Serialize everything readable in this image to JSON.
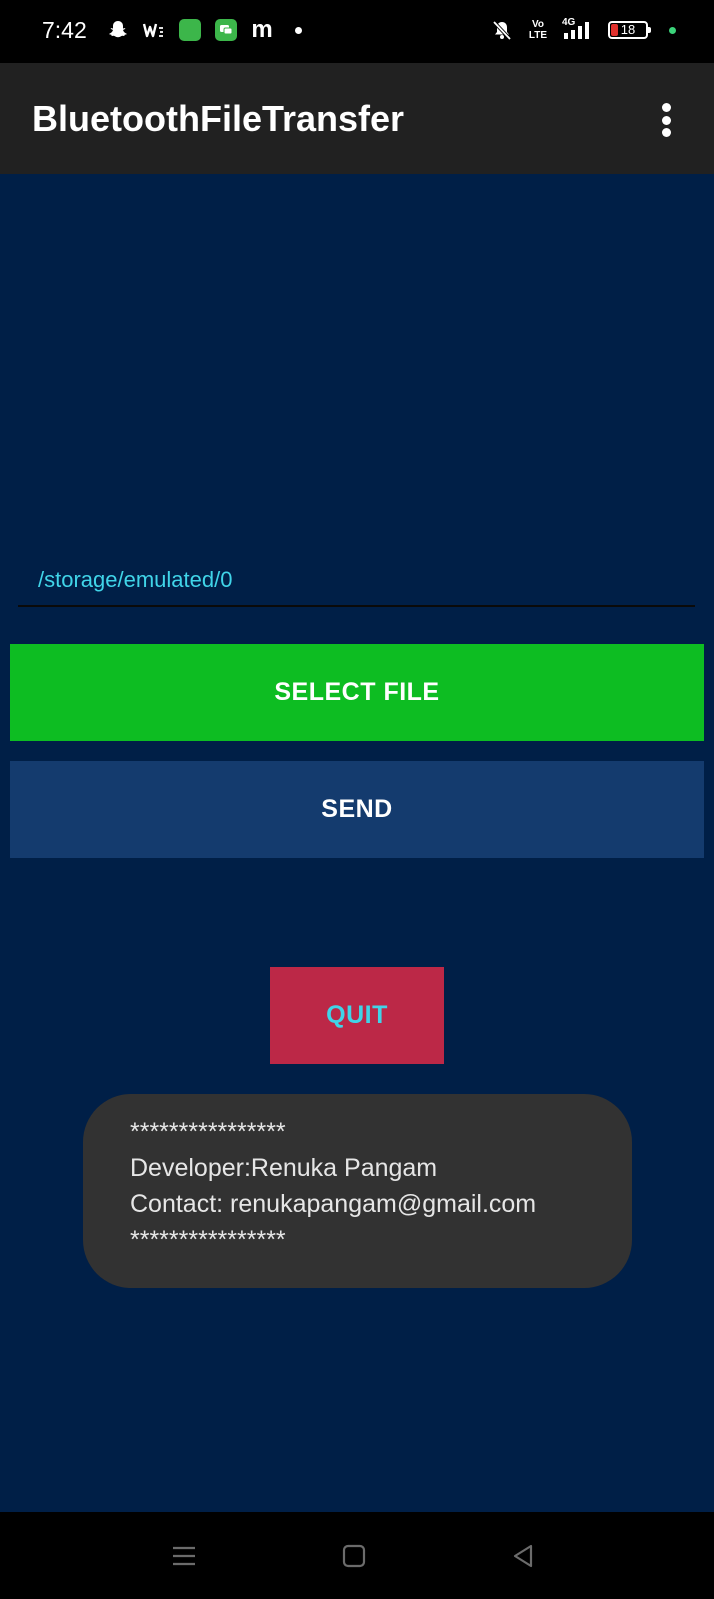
{
  "status_bar": {
    "time": "7:42",
    "battery_level": "18",
    "left_icons": [
      "snapchat-icon",
      "wifi-calling-icon",
      "green-app-icon",
      "messages-icon",
      "m-app-icon",
      "notification-dot"
    ],
    "right_icons": [
      "bell-muted-icon",
      "volte-icon",
      "signal-4g-icon",
      "battery-icon",
      "green-dot"
    ],
    "volte_label_top": "Vo",
    "volte_label_bottom": "LTE",
    "network_label": "4G"
  },
  "app_bar": {
    "title": "BluetoothFileTransfer",
    "menu_icon": "overflow-menu-icon"
  },
  "main": {
    "path_value": "/storage/emulated/0",
    "select_file_label": "SELECT FILE",
    "send_label": "SEND",
    "quit_label": "QUIT"
  },
  "toast": {
    "line1": "****************",
    "line2": "Developer:Renuka Pangam",
    "line3": "Contact: renukapangam@gmail.com",
    "line4": "****************"
  },
  "nav_bar": {
    "icons": [
      "recent-apps-icon",
      "home-icon",
      "back-icon"
    ]
  },
  "colors": {
    "background": "#001f47",
    "app_bar": "#212121",
    "select_button": "#0dbd22",
    "send_button": "#143b6e",
    "quit_button": "#bc2847",
    "accent_text": "#40d4e8",
    "toast": "#323232"
  }
}
